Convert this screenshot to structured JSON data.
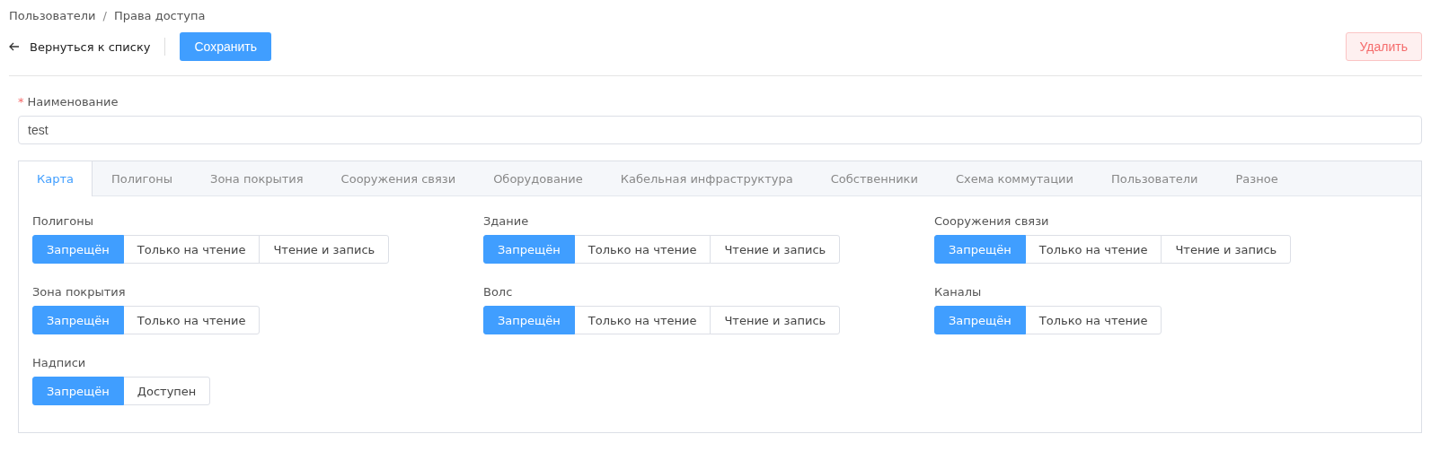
{
  "breadcrumbs": [
    "Пользователи",
    "Права доступа"
  ],
  "breadcrumb_separator": "/",
  "toolbar": {
    "back": "Вернуться к списку",
    "save": "Сохранить",
    "delete": "Удалить"
  },
  "name_field": {
    "label": "Наименование",
    "required_mark": "*",
    "value": "test"
  },
  "tabs": [
    {
      "label": "Карта",
      "selected": true
    },
    {
      "label": "Полигоны",
      "selected": false
    },
    {
      "label": "Зона покрытия",
      "selected": false
    },
    {
      "label": "Сооружения связи",
      "selected": false
    },
    {
      "label": "Оборудование",
      "selected": false
    },
    {
      "label": "Кабельная инфраструктура",
      "selected": false
    },
    {
      "label": "Собственники",
      "selected": false
    },
    {
      "label": "Схема коммутации",
      "selected": false
    },
    {
      "label": "Пользователи",
      "selected": false
    },
    {
      "label": "Разное",
      "selected": false
    }
  ],
  "permissions": [
    {
      "label": "Полигоны",
      "options": [
        {
          "label": "Запрещён",
          "selected": true
        },
        {
          "label": "Только на чтение",
          "selected": false
        },
        {
          "label": "Чтение и запись",
          "selected": false
        }
      ]
    },
    {
      "label": "Здание",
      "options": [
        {
          "label": "Запрещён",
          "selected": true
        },
        {
          "label": "Только на чтение",
          "selected": false
        },
        {
          "label": "Чтение и запись",
          "selected": false
        }
      ]
    },
    {
      "label": "Сооружения связи",
      "options": [
        {
          "label": "Запрещён",
          "selected": true
        },
        {
          "label": "Только на чтение",
          "selected": false
        },
        {
          "label": "Чтение и запись",
          "selected": false
        }
      ]
    },
    {
      "label": "Зона покрытия",
      "options": [
        {
          "label": "Запрещён",
          "selected": true
        },
        {
          "label": "Только на чтение",
          "selected": false
        }
      ]
    },
    {
      "label": "Волс",
      "options": [
        {
          "label": "Запрещён",
          "selected": true
        },
        {
          "label": "Только на чтение",
          "selected": false
        },
        {
          "label": "Чтение и запись",
          "selected": false
        }
      ]
    },
    {
      "label": "Каналы",
      "options": [
        {
          "label": "Запрещён",
          "selected": true
        },
        {
          "label": "Только на чтение",
          "selected": false
        }
      ]
    },
    {
      "label": "Надписи",
      "options": [
        {
          "label": "Запрещён",
          "selected": true
        },
        {
          "label": "Доступен",
          "selected": false
        }
      ]
    }
  ]
}
